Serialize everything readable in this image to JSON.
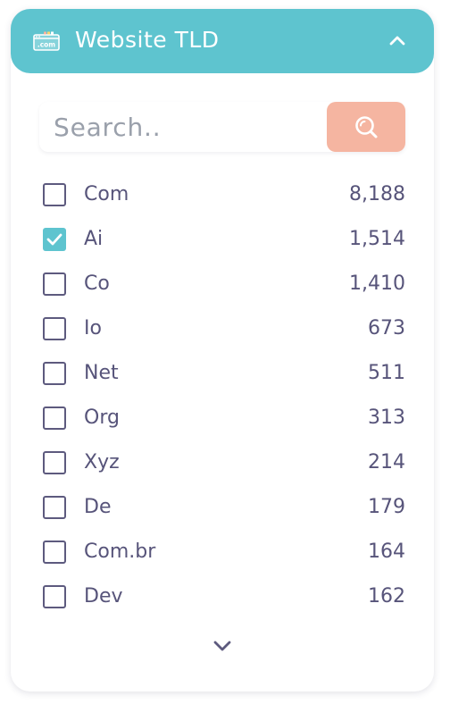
{
  "header": {
    "title": "Website TLD",
    "icon": "com-domain-icon",
    "icon_text": ".com",
    "collapse_icon": "chevron-up-icon",
    "color": "#5ec4cf"
  },
  "search": {
    "placeholder": "Search..",
    "value": "",
    "button_icon": "search-icon",
    "button_color": "#f5b5a1"
  },
  "filters": [
    {
      "label": "Com",
      "count": "8,188",
      "checked": false
    },
    {
      "label": "Ai",
      "count": "1,514",
      "checked": true
    },
    {
      "label": "Co",
      "count": "1,410",
      "checked": false
    },
    {
      "label": "Io",
      "count": "673",
      "checked": false
    },
    {
      "label": "Net",
      "count": "511",
      "checked": false
    },
    {
      "label": "Org",
      "count": "313",
      "checked": false
    },
    {
      "label": "Xyz",
      "count": "214",
      "checked": false
    },
    {
      "label": "De",
      "count": "179",
      "checked": false
    },
    {
      "label": "Com.br",
      "count": "164",
      "checked": false
    },
    {
      "label": "Dev",
      "count": "162",
      "checked": false
    }
  ],
  "show_more_icon": "chevron-down-icon",
  "colors": {
    "text": "#57547a",
    "checkbox_border": "#5d5a7e",
    "checked": "#5ec4cf"
  }
}
